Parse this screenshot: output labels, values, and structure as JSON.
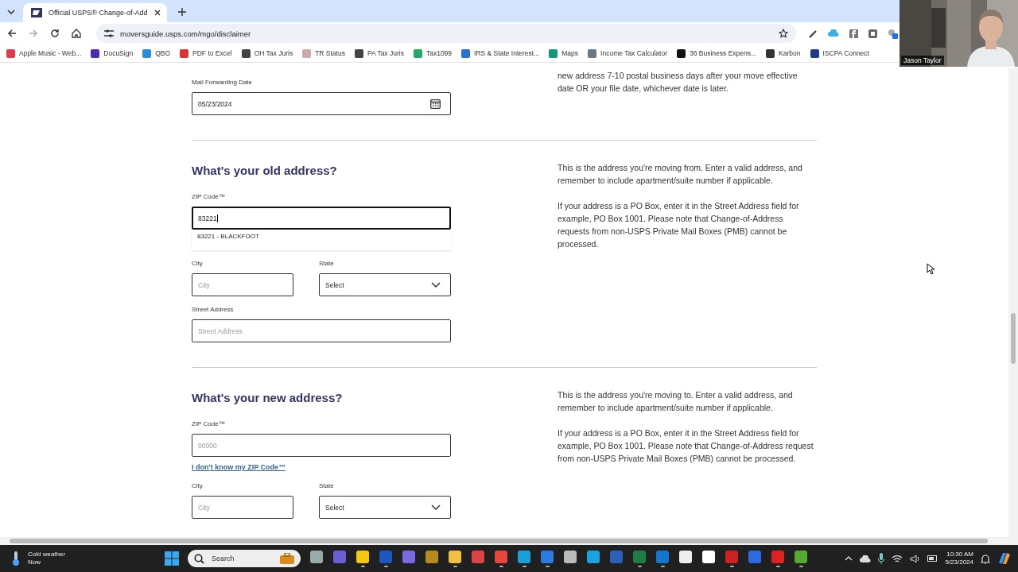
{
  "browser": {
    "tab": {
      "title": "Official USPS® Change-of-Add",
      "selected": true
    },
    "address": "moversguide.usps.com/mgo/disclaimer",
    "bookmarks": [
      "Apple Music - Web...",
      "DocuSign",
      "QBO",
      "PDF to Excel",
      "OH Tax Juris",
      "TR Status",
      "PA Tax Juris",
      "Tax1099",
      "IRS & State Interest...",
      "Maps",
      "Income Tax Calculator",
      "36 Business Expens...",
      "Karbon",
      "ISCPA Connect"
    ]
  },
  "webcam": {
    "name": "Jason Taylor"
  },
  "form": {
    "date_note": [
      "new address 7-10 postal business days after your move effective",
      "date OR your file date, whichever date is later."
    ],
    "mail_forwarding": {
      "label": "Mail Forwarding Date",
      "value": "05/23/2024"
    },
    "sections": [
      {
        "heading": "What's your old address?",
        "zip_label": "ZIP Code™",
        "zip_value": "83221",
        "focused": true,
        "suggestion": "83221 - BLACKFOOT",
        "city_label": "City",
        "city_placeholder": "City",
        "state_label": "State",
        "state_value": "Select",
        "street_label": "Street Address",
        "street_placeholder": "Street Address",
        "notes": [
          "This is the address you're moving from. Enter a valid address, and remember to include apartment/suite number if applicable.",
          "If your address is a PO Box, enter it in the Street Address field for example, PO Box 1001. Please note that Change-of-Address requests from non-USPS Private Mail Boxes (PMB) cannot be processed."
        ]
      },
      {
        "heading": "What's your new address?",
        "zip_label": "ZIP Code™",
        "zip_placeholder": "00000",
        "focused": false,
        "link": "I don't know my ZIP Code™",
        "city_label": "City",
        "city_placeholder": "City",
        "state_label": "State",
        "state_value": "Select",
        "notes": [
          "This is the address you're moving to. Enter a valid address, and remember to include apartment/suite number if applicable.",
          "If your address is a PO Box, enter it in the Street Address field for example, PO Box 1001. Please note that Change-of-Address request from non-USPS Private Mail Boxes (PMB) cannot be processed."
        ]
      }
    ]
  },
  "taskbar": {
    "weather": {
      "title": "Cold weather",
      "subtitle": "Now"
    },
    "search_placeholder": "Search",
    "apps": [
      {
        "running": false
      },
      {
        "running": false
      },
      {
        "running": true
      },
      {
        "running": true
      },
      {
        "running": false
      },
      {
        "running": false
      },
      {
        "running": true
      },
      {
        "running": false
      },
      {
        "running": true
      },
      {
        "running": true
      },
      {
        "running": true
      },
      {
        "running": false
      },
      {
        "running": false
      },
      {
        "running": false
      },
      {
        "running": true
      },
      {
        "running": true
      },
      {
        "running": false
      },
      {
        "running": false
      },
      {
        "running": true
      },
      {
        "running": false
      },
      {
        "running": true
      },
      {
        "running": true
      }
    ],
    "time": "10:30 AM",
    "date": "5/23/2024"
  }
}
